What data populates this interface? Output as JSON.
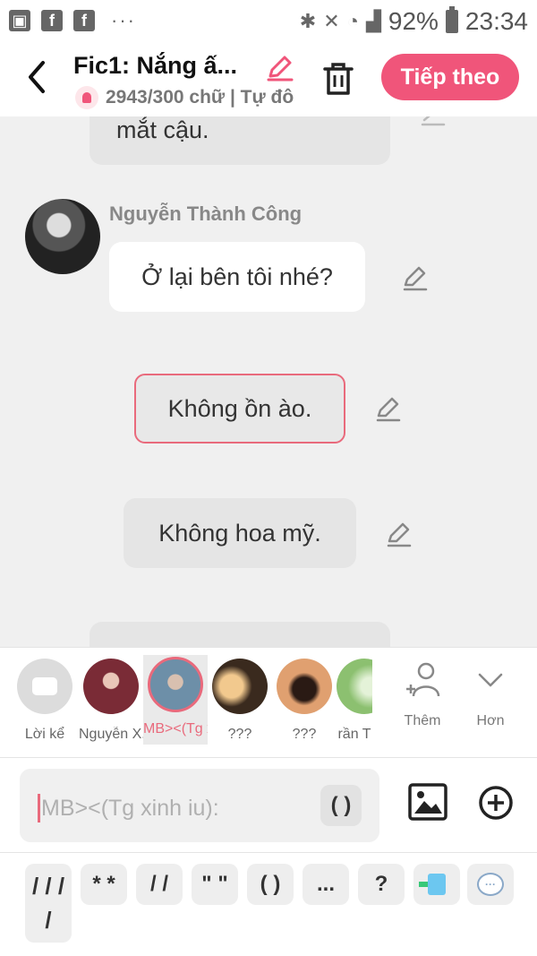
{
  "status_bar": {
    "battery": "92%",
    "time": "23:34",
    "icons": [
      "image-icon",
      "facebook-icon",
      "facebook-icon",
      "more-dots",
      "bluetooth-icon",
      "mute-icon",
      "wifi-icon",
      "signal-icon",
      "battery-icon"
    ]
  },
  "header": {
    "title": "Fic1: Nắng ấ...",
    "subtitle": "2943/300 chữ | Tự đô",
    "next_label": "Tiếp theo"
  },
  "chat": {
    "top_message": "mắt cậu.",
    "speaker": "Nguyễn Thành Công",
    "white_message": "Ở lại bên tôi nhé?",
    "selected_message": "Không ồn ào.",
    "gray_message": "Không hoa mỹ."
  },
  "characters": [
    {
      "label": "Lời kể"
    },
    {
      "label": "Nguyễn X..."
    },
    {
      "label": "MB><(Tg x..."
    },
    {
      "label": "???"
    },
    {
      "label": "???"
    },
    {
      "label": "rần T"
    }
  ],
  "actions": {
    "add_label": "Thêm",
    "more_label": "Hơn"
  },
  "input": {
    "placeholder": "MB><(Tg xinh iu):",
    "paren_button": "( )"
  },
  "quick_keys": [
    "/ / /\n/",
    "* *",
    "/ /",
    "\" \"",
    "( )",
    "...",
    "?"
  ],
  "colors": {
    "accent": "#f0557a",
    "selected_border": "#e96a7c",
    "background": "#f0f0f0"
  }
}
